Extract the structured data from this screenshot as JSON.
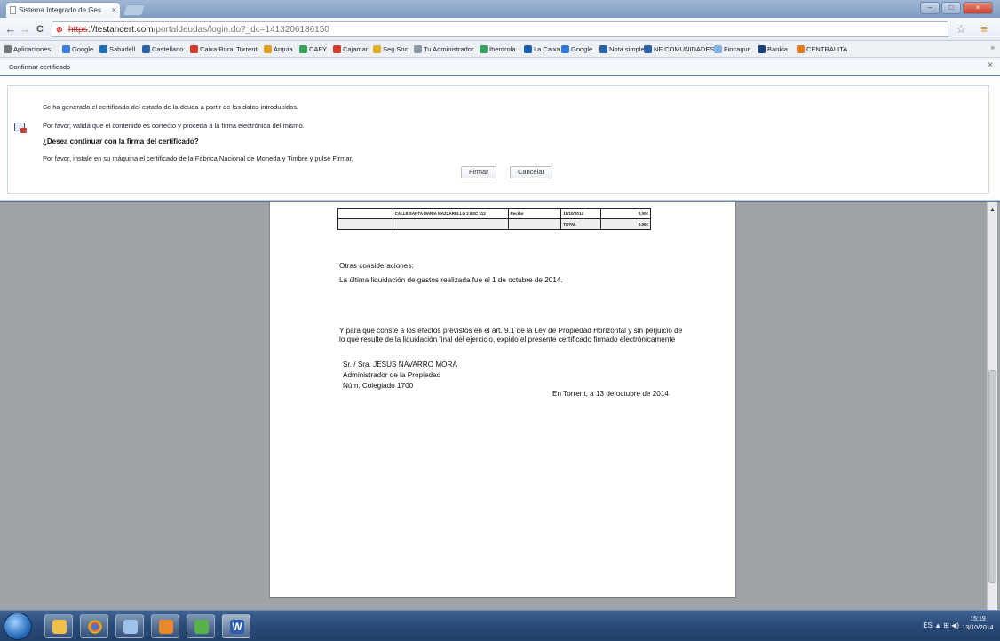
{
  "browser": {
    "tab_title": "Sistema Integrado de Ges",
    "url_scheme": "https",
    "url_host": "://testancert.com",
    "url_path": "/portaldeudas/login.do?_dc=1413206186150",
    "back_glyph": "←",
    "forward_glyph": "→",
    "reload_glyph": "C",
    "star_glyph": "☆",
    "menu_glyph": "≡"
  },
  "bookmarks": [
    {
      "label": "Aplicaciones",
      "color": "#777777"
    },
    {
      "label": "Google",
      "color": "#3b7ddd"
    },
    {
      "label": "Sabadell",
      "color": "#1d6fb8"
    },
    {
      "label": "Castellano",
      "color": "#2a62a8"
    },
    {
      "label": "Caixa Rural Torrent",
      "color": "#d23a2a"
    },
    {
      "label": "Arquia",
      "color": "#e0a020"
    },
    {
      "label": "CAFY",
      "color": "#3aa15a"
    },
    {
      "label": "Cajamar",
      "color": "#d23a2a"
    },
    {
      "label": "Seg.Soc.",
      "color": "#e0b020"
    },
    {
      "label": "Tu Administrador",
      "color": "#8899aa"
    },
    {
      "label": "Iberdrola",
      "color": "#3aa15a"
    },
    {
      "label": "La Caixa",
      "color": "#1d5fb8"
    },
    {
      "label": "Google",
      "color": "#2d7bd8"
    },
    {
      "label": "Nota simple",
      "color": "#2a62a8"
    },
    {
      "label": "NF COMUNIDADES",
      "color": "#2a62a8"
    },
    {
      "label": "Fincagur",
      "color": "#7fb3e8"
    },
    {
      "label": "Bankia",
      "color": "#1d3f7a"
    },
    {
      "label": "CENTRALITA",
      "color": "#e07a20"
    }
  ],
  "bookmarks_more": "»",
  "infobar": {
    "title": "Confirmar certificado",
    "close_glyph": "×",
    "line1": "Se ha generado el certificado del estado de la deuda a partir de los datos introducidos.",
    "line2": "Por favor, valida que el contenido es correcto y proceda a la firma electrónica del mismo.",
    "question": "¿Desea continuar con la firma del certificado?",
    "line3": "Por favor, instale en su máquina el certificado de la Fábrica Nacional de Moneda y Timbre y pulse Firmar.",
    "btn_sign": "Firmar",
    "btn_cancel": "Cancelar"
  },
  "document": {
    "table": {
      "row1": {
        "c1": "",
        "c2": "CALLE SANTA MARIA MAZZARELLO 2 ESC 112",
        "c3": "Recibo",
        "c4": "15/10/2014",
        "c5": "0,00€"
      },
      "row2": {
        "c1": "",
        "c2": "",
        "c3": "",
        "c4": "TOTAL",
        "c5": "0,00€"
      }
    },
    "heading": "Otras consideraciones:",
    "last_liquidation": "La última liquidación de gastos realizada fue el 1 de octubre de 2014.",
    "statement": "Y para que conste a los efectos previstos en el art. 9.1 de la Ley de Propiedad Horizontal y sin perjuicio de lo que resulte de la liquidación final del ejercicio, expido el presente certificado firmado electrónicamente",
    "signer": "Sr. / Sra. JESUS NAVARRO MORA",
    "role": "Administrador de la Propiedad",
    "registration": "Núm. Colegiado 1700",
    "place_date": "En Torrent, a 13 de octubre de 2014"
  },
  "scrollbar": {
    "up_glyph": "▲"
  },
  "taskbar": {
    "apps": [
      {
        "name": "explorer",
        "color": "#f0c04a"
      },
      {
        "name": "chrome",
        "color": "#e24a3a"
      },
      {
        "name": "generic",
        "color": "#9fc2ea"
      },
      {
        "name": "outlook",
        "color": "#e9892b"
      },
      {
        "name": "paint",
        "color": "#5ab04a"
      },
      {
        "name": "word",
        "color": "#2a5db0"
      }
    ],
    "word_letter": "W",
    "tray": "ES  ▲  ⊞  ◀)",
    "time": "15:19",
    "date": "13/10/2014"
  }
}
